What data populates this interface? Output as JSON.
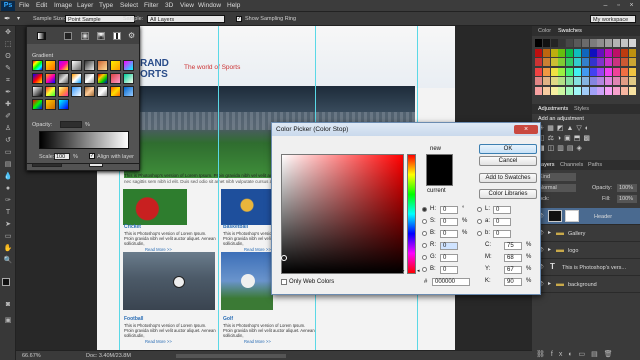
{
  "menu": {
    "app_icon": "Ps",
    "items": [
      "File",
      "Edit",
      "Image",
      "Layer",
      "Type",
      "Select",
      "Filter",
      "3D",
      "View",
      "Window",
      "Help"
    ],
    "workspace": "My workspace"
  },
  "options": {
    "sample_size_label": "Sample Size:",
    "sample_size_value": "Point Sample",
    "sample_label": "Sample:",
    "sample_value": "All Layers",
    "show_ring_label": "Show Sampling Ring"
  },
  "gradient_panel": {
    "section_label": "Gradient",
    "opacity_label": "Opacity:",
    "opacity_unit": "%",
    "mode_value": "Linear",
    "scale_label": "Scale:",
    "scale_value": "100",
    "scale_unit": "%",
    "align_label": "Align with layer",
    "angle_value": "90"
  },
  "document": {
    "logo_line1": "RAND",
    "logo_line2": "ORTS",
    "tagline": "The world of Sports",
    "intro_line1": "This is Photoshop's version  of Lorem Ipsum. Proin gravida nibh vel velit auctor aliquet. Aenean sollicitudin, lorem quis",
    "intro_line2": "nec sagittis sem nibh id elit. Duis sed odio sit amet nibh vulputate cursus a sit amet mauris.",
    "cards": [
      {
        "title": "Cricket",
        "text": "This is Photoshop's version of Lorem Ipsum. Proin gravida nibh vel velit auctor aliquet. Aenean sollicitudin,",
        "more": "Read More >>"
      },
      {
        "title": "Basketball",
        "text": "This is Photoshop's version of Lorem Ipsum. Proin gravida nibh vel velit auctor aliquet. Aenean sollicitudin,",
        "more": "Read More >>"
      },
      {
        "title": "Football",
        "text": "This is Photoshop's version of Lorem Ipsum. Proin gravida nibh vel velit auctor aliquet. Aenean sollicitudin,",
        "more": "Read More >>"
      },
      {
        "title": "Golf",
        "text": "This is Photoshop's version of Lorem Ipsum. Proin gravida nibh vel velit auctor aliquet. Aenean sollicitudin,",
        "more": "Read More >>"
      }
    ]
  },
  "status": {
    "zoom": "66.67%",
    "doc": "Doc: 3.40M/23.8M"
  },
  "dialog": {
    "title": "Color Picker (Color Stop)",
    "ok": "OK",
    "cancel": "Cancel",
    "add_swatches": "Add to Swatches",
    "libraries": "Color Libraries",
    "new_label": "new",
    "current_label": "current",
    "only_web": "Only Web Colors",
    "h_label": "H:",
    "h_val": "0",
    "h_unit": "°",
    "s_label": "S:",
    "s_val": "0",
    "s_unit": "%",
    "b_label": "B:",
    "b_val": "0",
    "b_unit": "%",
    "r_label": "R:",
    "r_val": "0",
    "g_label": "G:",
    "g_val": "0",
    "bb_label": "B:",
    "bb_val": "0",
    "l_label": "L:",
    "l_val": "0",
    "a_label": "a:",
    "a_val": "0",
    "b2_label": "b:",
    "b2_val": "0",
    "c_label": "C:",
    "c_val": "75",
    "c_unit": "%",
    "m_label": "M:",
    "m_val": "68",
    "m_unit": "%",
    "y_label": "Y:",
    "y_val": "67",
    "y_unit": "%",
    "k_label": "K:",
    "k_val": "90",
    "k_unit": "%",
    "hex_label": "#",
    "hex_val": "000000"
  },
  "right": {
    "tab_color": "Color",
    "tab_swatches": "Swatches",
    "tab_adjust": "Adjustments",
    "tab_styles": "Styles",
    "add_adjust": "Add an adjustment",
    "tab_layers": "Layers",
    "tab_channels": "Channels",
    "tab_paths": "Paths",
    "kind": "Kind",
    "normal": "Normal",
    "opacity_label": "Opacity:",
    "opacity_val": "100%",
    "lock_label": "Lock:",
    "fill_label": "Fill:",
    "fill_val": "100%",
    "layers": [
      {
        "name": "Header"
      },
      {
        "name": "Gallery"
      },
      {
        "name": "logo"
      },
      {
        "name": "This is Photoshop's vers..."
      },
      {
        "name": "background"
      }
    ]
  }
}
